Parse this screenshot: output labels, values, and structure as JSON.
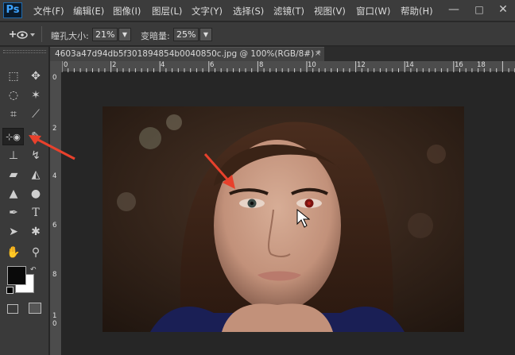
{
  "app": {
    "logo": "Ps"
  },
  "menu": [
    {
      "label": "文件(F)"
    },
    {
      "label": "编辑(E)"
    },
    {
      "label": "图像(I)"
    },
    {
      "label": "图层(L)"
    },
    {
      "label": "文字(Y)"
    },
    {
      "label": "选择(S)"
    },
    {
      "label": "滤镜(T)"
    },
    {
      "label": "视图(V)"
    },
    {
      "label": "窗口(W)"
    },
    {
      "label": "帮助(H)"
    }
  ],
  "window_controls": {
    "minimize": "—",
    "maximize": "□",
    "close": "✕"
  },
  "options_bar": {
    "tool_icon": "red-eye-tool-icon",
    "pupil_size_label": "瞳孔大小:",
    "pupil_size_value": "21%",
    "darken_label": "变暗量:",
    "darken_value": "25%"
  },
  "document": {
    "tab_title": "4603a47d94db5f301894854b0040850c.jpg @ 100%(RGB/8#) *",
    "close": "×"
  },
  "ruler_top": [
    "0",
    "2",
    "4",
    "6",
    "8",
    "10",
    "12",
    "14",
    "16",
    "18"
  ],
  "ruler_left": [
    "0",
    "2",
    "4",
    "6",
    "8",
    "1",
    "0"
  ],
  "tools": [
    {
      "name": "marquee-tool-icon",
      "glyph": "⬚"
    },
    {
      "name": "move-tool-icon",
      "glyph": "✥"
    },
    {
      "name": "lasso-tool-icon",
      "glyph": "◌"
    },
    {
      "name": "magic-wand-tool-icon",
      "glyph": "✶"
    },
    {
      "name": "crop-tool-icon",
      "glyph": "⌗"
    },
    {
      "name": "eyedropper-tool-icon",
      "glyph": "⟋"
    },
    {
      "name": "red-eye-tool-icon",
      "glyph": "⊹◉"
    },
    {
      "name": "brush-tool-icon",
      "glyph": "✎"
    },
    {
      "name": "stamp-tool-icon",
      "glyph": "⊥"
    },
    {
      "name": "history-brush-tool-icon",
      "glyph": "↯"
    },
    {
      "name": "eraser-tool-icon",
      "glyph": "▰"
    },
    {
      "name": "paint-bucket-tool-icon",
      "glyph": "◭"
    },
    {
      "name": "blur-tool-icon",
      "glyph": "▲"
    },
    {
      "name": "dodge-tool-icon",
      "glyph": "●"
    },
    {
      "name": "pen-tool-icon",
      "glyph": "✒"
    },
    {
      "name": "type-tool-icon",
      "glyph": "T"
    },
    {
      "name": "path-select-tool-icon",
      "glyph": "➤"
    },
    {
      "name": "shape-tool-icon",
      "glyph": "✱"
    },
    {
      "name": "hand-tool-icon",
      "glyph": "✋"
    },
    {
      "name": "zoom-tool-icon",
      "glyph": "⚲"
    }
  ],
  "colors": {
    "foreground": "#0a0a0a",
    "background": "#ffffff",
    "annotation_arrow": "#e8412c"
  }
}
